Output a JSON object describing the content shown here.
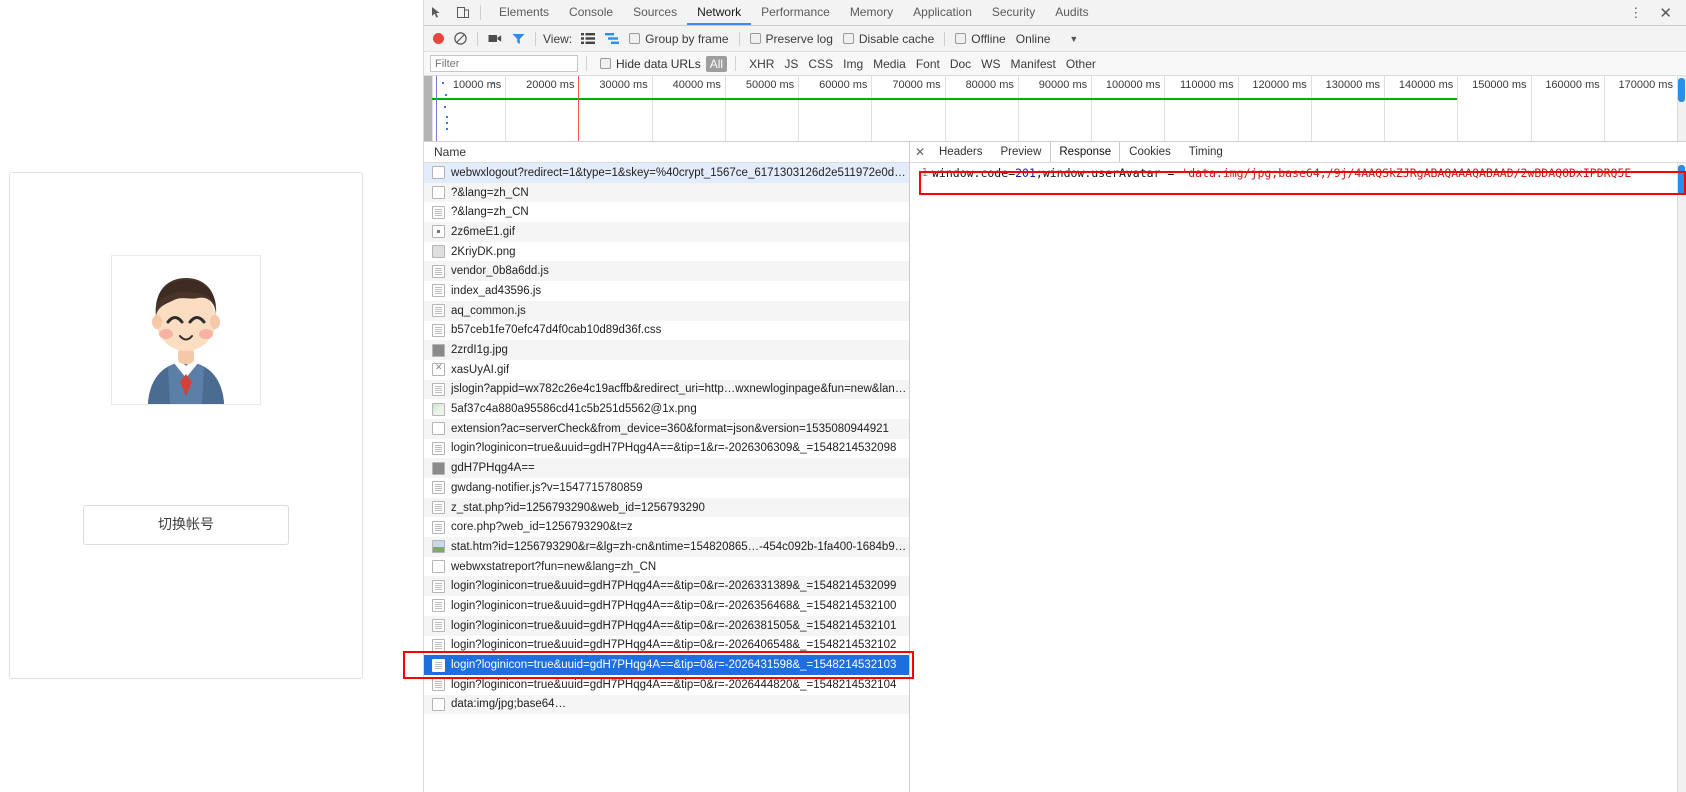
{
  "webpage": {
    "switch_account_label": "切换帐号",
    "avatar_alt": "cartoon-boy-avatar"
  },
  "devtools": {
    "tabs": [
      "Elements",
      "Console",
      "Sources",
      "Network",
      "Performance",
      "Memory",
      "Application",
      "Security",
      "Audits"
    ],
    "active_tab": "Network",
    "inspect_icon": "inspect-element-icon",
    "device_icon": "device-toolbar-icon",
    "more_label": "⋮",
    "close_label": "✕"
  },
  "network_toolbar": {
    "record_title": "record-button",
    "clear_title": "clear-button",
    "capture_screenshots_title": "camera-icon",
    "filter_title": "filter-icon",
    "view_label": "View:",
    "view_list_icon": "list-view-icon",
    "view_waterfall_icon": "waterfall-view-icon",
    "group_by_frame": "Group by frame",
    "preserve_log": "Preserve log",
    "disable_cache": "Disable cache",
    "offline": "Offline",
    "throttling": "Online",
    "throttle_arrow": "▼"
  },
  "filter_bar": {
    "placeholder": "Filter",
    "value": "",
    "hide_data_urls": "Hide data URLs",
    "types": [
      "All",
      "XHR",
      "JS",
      "CSS",
      "Img",
      "Media",
      "Font",
      "Doc",
      "WS",
      "Manifest",
      "Other"
    ],
    "selected_type": "All"
  },
  "timeline": {
    "ticks": [
      "10000 ms",
      "20000 ms",
      "30000 ms",
      "40000 ms",
      "50000 ms",
      "60000 ms",
      "70000 ms",
      "80000 ms",
      "90000 ms",
      "100000 ms",
      "110000 ms",
      "120000 ms",
      "130000 ms",
      "140000 ms",
      "150000 ms",
      "160000 ms",
      "170000 ms"
    ],
    "green_line_color": "#00b200",
    "blue_marker_color": "#7a7ad0",
    "red_marker_color": "#f05a5a"
  },
  "request_list": {
    "column_header": "Name",
    "rows": [
      {
        "name": "webwxlogout?redirect=1&type=1&skey=%40crypt_1567ce_6171303126d2e511972e0ddd1…",
        "icon": "blank",
        "state": "first"
      },
      {
        "name": "?&lang=zh_CN",
        "icon": "blank",
        "state": ""
      },
      {
        "name": "?&lang=zh_CN",
        "icon": "doc",
        "state": ""
      },
      {
        "name": "2z6meE1.gif",
        "icon": "imgsm",
        "state": ""
      },
      {
        "name": "2KriyDK.png",
        "icon": "img",
        "state": ""
      },
      {
        "name": "vendor_0b8a6dd.js",
        "icon": "doc",
        "state": ""
      },
      {
        "name": "index_ad43596.js",
        "icon": "doc",
        "state": ""
      },
      {
        "name": "aq_common.js",
        "icon": "doc",
        "state": ""
      },
      {
        "name": "b57ceb1fe70efc47d4f0cab10d89d36f.css",
        "icon": "doc",
        "state": ""
      },
      {
        "name": "2zrdI1g.jpg",
        "icon": "imgdark",
        "state": ""
      },
      {
        "name": "xasUyAI.gif",
        "icon": "gifx",
        "state": ""
      },
      {
        "name": "jslogin?appid=wx782c26e4c19acffb&redirect_uri=http…wxnewloginpage&fun=new&lang=…",
        "icon": "doc",
        "state": ""
      },
      {
        "name": "5af37c4a880a95586cd41c5b251d5562@1x.png",
        "icon": "pic",
        "state": ""
      },
      {
        "name": "extension?ac=serverCheck&from_device=360&format=json&version=1535080944921",
        "icon": "blank",
        "state": ""
      },
      {
        "name": "login?loginicon=true&uuid=gdH7PHqg4A==&tip=1&r=-2026306309&_=1548214532098",
        "icon": "doc",
        "state": ""
      },
      {
        "name": "gdH7PHqg4A==",
        "icon": "imgdark",
        "state": ""
      },
      {
        "name": "gwdang-notifier.js?v=1547715780859",
        "icon": "doc",
        "state": ""
      },
      {
        "name": "z_stat.php?id=1256793290&web_id=1256793290",
        "icon": "doc",
        "state": ""
      },
      {
        "name": "core.php?web_id=1256793290&t=z",
        "icon": "doc",
        "state": ""
      },
      {
        "name": "stat.htm?id=1256793290&r=&lg=zh-cn&ntime=154820865…-454c092b-1fa400-1684b932…",
        "icon": "photo",
        "state": ""
      },
      {
        "name": "webwxstatreport?fun=new&lang=zh_CN",
        "icon": "blank",
        "state": ""
      },
      {
        "name": "login?loginicon=true&uuid=gdH7PHqg4A==&tip=0&r=-2026331389&_=1548214532099",
        "icon": "doc",
        "state": ""
      },
      {
        "name": "login?loginicon=true&uuid=gdH7PHqg4A==&tip=0&r=-2026356468&_=1548214532100",
        "icon": "doc",
        "state": ""
      },
      {
        "name": "login?loginicon=true&uuid=gdH7PHqg4A==&tip=0&r=-2026381505&_=1548214532101",
        "icon": "doc",
        "state": ""
      },
      {
        "name": "login?loginicon=true&uuid=gdH7PHqg4A==&tip=0&r=-2026406548&_=1548214532102",
        "icon": "doc",
        "state": ""
      },
      {
        "name": "login?loginicon=true&uuid=gdH7PHqg4A==&tip=0&r=-2026431598&_=1548214532103",
        "icon": "doc",
        "state": "selected"
      },
      {
        "name": "login?loginicon=true&uuid=gdH7PHqg4A==&tip=0&r=-2026444820&_=1548214532104",
        "icon": "doc",
        "state": ""
      },
      {
        "name": "data:img/jpg;base64…",
        "icon": "upload",
        "state": ""
      }
    ]
  },
  "detail_panel": {
    "close_icon": "✕",
    "tabs": [
      "Headers",
      "Preview",
      "Response",
      "Cookies",
      "Timing"
    ],
    "active_tab": "Response",
    "line_number": "1",
    "code": {
      "prefix": "window.code=",
      "code_value": "201",
      "middle": ";window.userAvatar = ",
      "string": "'data:img/jpg;base64,/9j/4AAQSkZJRgABAQAAAQABAAD/2wBDAQODxIPDRQ5E"
    }
  },
  "annotations": {
    "color": "#ff0000",
    "boxes": [
      "response-code-highlight",
      "selected-request-highlight"
    ]
  }
}
